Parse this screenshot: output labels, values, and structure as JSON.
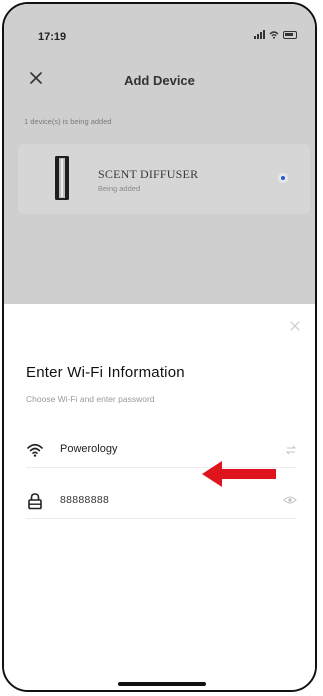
{
  "status_bar": {
    "time": "17:19"
  },
  "nav": {
    "title": "Add Device",
    "close_icon": "close-icon"
  },
  "adding_status": "1 device(s) is being added",
  "device": {
    "name": "SCENT DIFFUSER",
    "status": "Being added"
  },
  "sheet": {
    "title": "Enter Wi-Fi Information",
    "subtitle": "Choose Wi-Fi and enter password",
    "wifi_network": "Powerology",
    "password": "88888888",
    "icons": [
      "wifi-icon",
      "lock-icon",
      "switch-network-icon",
      "eye-icon",
      "close-icon"
    ]
  },
  "colors": {
    "accent": "#2a58d6",
    "annotation_arrow": "#e0141c",
    "overlay": "#cfcfcf"
  }
}
